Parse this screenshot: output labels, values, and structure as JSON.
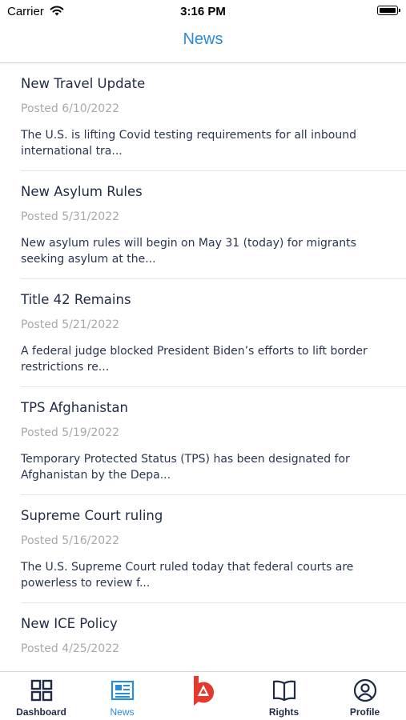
{
  "status": {
    "carrier": "Carrier",
    "time": "3:16 PM"
  },
  "header": {
    "title": "News"
  },
  "news": [
    {
      "title": "New Travel Update",
      "date": "Posted 6/10/2022",
      "excerpt": "The U.S. is lifting Covid testing requirements for all inbound international tra..."
    },
    {
      "title": "New Asylum Rules",
      "date": "Posted 5/31/2022",
      "excerpt": "New asylum rules will begin on May 31 (today) for migrants seeking asylum at the..."
    },
    {
      "title": "Title 42 Remains",
      "date": "Posted 5/21/2022",
      "excerpt": "A federal judge blocked President Biden’s efforts to lift border restrictions re..."
    },
    {
      "title": "TPS Afghanistan",
      "date": "Posted 5/19/2022",
      "excerpt": "Temporary Protected Status (TPS) has been designated for Afghanistan by the Depa..."
    },
    {
      "title": "Supreme Court ruling",
      "date": "Posted 5/16/2022",
      "excerpt": "The U.S. Supreme Court ruled today that federal courts are powerless to review f..."
    },
    {
      "title": "New ICE Policy",
      "date": "Posted 4/25/2022",
      "excerpt": ""
    }
  ],
  "tabs": [
    {
      "label": "Dashboard",
      "icon": "grid-icon"
    },
    {
      "label": "News",
      "icon": "newspaper-icon",
      "active": true
    },
    {
      "label": "",
      "icon": "brand-logo-icon"
    },
    {
      "label": "Rights",
      "icon": "book-icon"
    },
    {
      "label": "Profile",
      "icon": "user-icon"
    }
  ],
  "colors": {
    "accent": "#2a8bd8",
    "brand_red": "#e23b2e",
    "text": "#1f2a44",
    "muted": "#a8a8a8"
  }
}
